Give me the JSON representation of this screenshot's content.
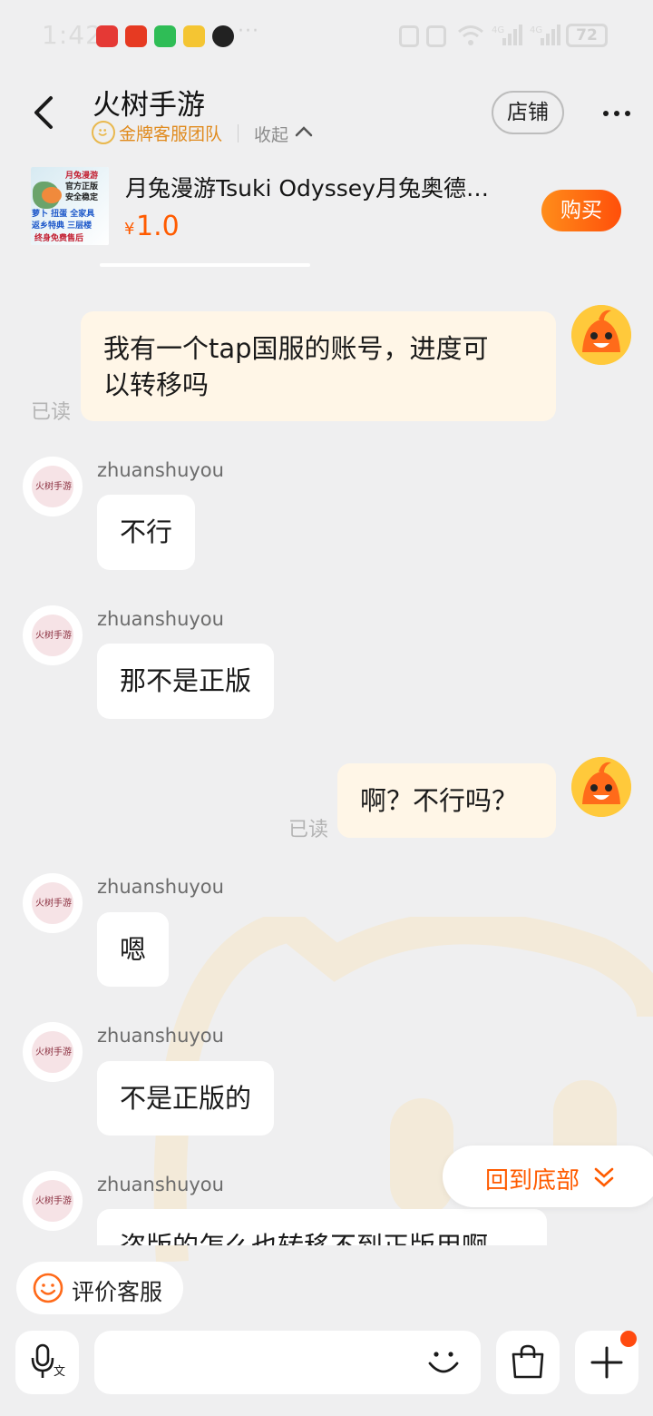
{
  "status_bar": {
    "time": "1:42",
    "more": "···",
    "battery": "72"
  },
  "header": {
    "title": "火树手游",
    "team_label": "金牌客服团队",
    "collapse_label": "收起",
    "store_button": "店铺"
  },
  "product": {
    "image_lines": [
      "月兔漫游",
      "官方正版",
      "安全稳定",
      "萝卜 扭蛋 全家具",
      "返乡特典 三层楼",
      "终身免费售后"
    ],
    "name": "月兔漫游Tsuki Odyssey月兔奥德…",
    "price_symbol": "¥",
    "price": "1.0",
    "buy_button": "购买"
  },
  "messages": [
    {
      "from": "me",
      "text_line1": "我有一个tap国服的账号，进度可",
      "text_line2": "以转移吗",
      "read": "已读"
    },
    {
      "from": "shop",
      "sender": "zhuanshuyou",
      "text": "不行"
    },
    {
      "from": "shop",
      "sender": "zhuanshuyou",
      "text": "那不是正版"
    },
    {
      "from": "me",
      "text": "啊？不行吗？",
      "read": "已读"
    },
    {
      "from": "shop",
      "sender": "zhuanshuyou",
      "text": "嗯"
    },
    {
      "from": "shop",
      "sender": "zhuanshuyou",
      "text": "不是正版的"
    },
    {
      "from": "shop",
      "sender": "zhuanshuyou",
      "text": "盗版的怎么也转移不到正版用啊"
    }
  ],
  "shop_avatar_text": "火树手游",
  "back_to_bottom": "回到底部",
  "rate_service": "评价客服",
  "input": {
    "placeholder": "",
    "voice_small": "文"
  },
  "colors": {
    "accent": "#ff5b00",
    "gold": "#e08a1d",
    "my_bubble": "#fff6e7",
    "background": "#efeff0"
  }
}
